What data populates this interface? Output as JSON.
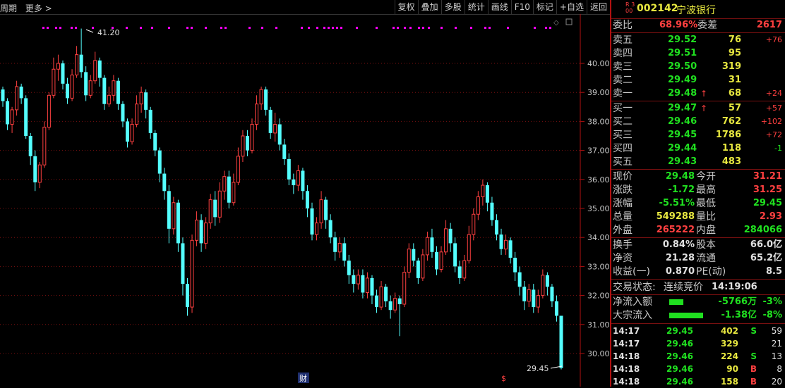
{
  "toolbar": {
    "left_items": [
      "周期",
      "更多 >"
    ],
    "buttons": [
      "复权",
      "叠加",
      "多股",
      "统计",
      "画线",
      "F10",
      "标记",
      "+自选",
      "返回"
    ]
  },
  "chart": {
    "price_ticks": [
      "40.00",
      "39.00",
      "38.00",
      "37.00",
      "36.00",
      "35.00",
      "34.00",
      "33.00",
      "32.00",
      "31.00",
      "30.00"
    ],
    "high_marker": "41.20",
    "low_marker": "29.45",
    "bottom_marks": [
      "财",
      "$"
    ],
    "colors": {
      "up": "#ff4040",
      "down": "#54ffff",
      "grid": "#7a1010",
      "signal": "#ff00ff"
    }
  },
  "quote": {
    "index_badge": "R 300",
    "code": "002142",
    "name": "宁波银行",
    "weibi_label": "委比",
    "weibi_value": "68.96%",
    "weicha_label": "委差",
    "weicha_value": "2617",
    "asks": [
      {
        "label": "卖五",
        "price": "29.52",
        "vol": "76",
        "chg": "+76",
        "arrow": ""
      },
      {
        "label": "卖四",
        "price": "29.51",
        "vol": "95",
        "chg": "",
        "arrow": ""
      },
      {
        "label": "卖三",
        "price": "29.50",
        "vol": "319",
        "chg": "",
        "arrow": ""
      },
      {
        "label": "卖二",
        "price": "29.49",
        "vol": "31",
        "chg": "",
        "arrow": ""
      },
      {
        "label": "卖一",
        "price": "29.48",
        "vol": "68",
        "chg": "+24",
        "arrow": "↑"
      }
    ],
    "bids": [
      {
        "label": "买一",
        "price": "29.47",
        "vol": "57",
        "chg": "+57",
        "arrow": "↑"
      },
      {
        "label": "买二",
        "price": "29.46",
        "vol": "762",
        "chg": "+102",
        "arrow": ""
      },
      {
        "label": "买三",
        "price": "29.45",
        "vol": "1786",
        "chg": "+72",
        "arrow": ""
      },
      {
        "label": "买四",
        "price": "29.44",
        "vol": "118",
        "chg": "-1",
        "arrow": ""
      },
      {
        "label": "买五",
        "price": "29.43",
        "vol": "483",
        "chg": "",
        "arrow": ""
      }
    ],
    "stats": [
      {
        "l1": "现价",
        "v1": "29.48",
        "c1": "green",
        "l2": "今开",
        "v2": "31.21",
        "c2": "red"
      },
      {
        "l1": "涨跌",
        "v1": "-1.72",
        "c1": "green",
        "l2": "最高",
        "v2": "31.25",
        "c2": "red"
      },
      {
        "l1": "涨幅",
        "v1": "-5.51%",
        "c1": "green",
        "l2": "最低",
        "v2": "29.45",
        "c2": "green"
      },
      {
        "l1": "总量",
        "v1": "549288",
        "c1": "yel",
        "l2": "量比",
        "v2": "2.93",
        "c2": "red"
      },
      {
        "l1": "外盘",
        "v1": "265222",
        "c1": "red",
        "l2": "内盘",
        "v2": "284066",
        "c2": "green"
      }
    ],
    "stats2": [
      {
        "l1": "换手",
        "v1": "0.84%",
        "l2": "股本",
        "v2": "66.0亿"
      },
      {
        "l1": "净资",
        "v1": "21.28",
        "l2": "流通",
        "v2": "65.2亿"
      },
      {
        "l1": "收益(一)",
        "v1": "0.870",
        "l2": "PE(动)",
        "v2": "8.5"
      }
    ],
    "trade_status_label": "交易状态:",
    "trade_status": "连续竞价",
    "trade_time": "14:19:06",
    "flows": [
      {
        "label": "净流入额",
        "value": "-5766万",
        "pct": "-3%",
        "bar": 0.28
      },
      {
        "label": "大宗流入",
        "value": "-1.38亿",
        "pct": "-8%",
        "bar": 0.68
      }
    ],
    "ticks": [
      {
        "time": "14:17",
        "price": "29.45",
        "vol": "402",
        "side": "S",
        "n": "59"
      },
      {
        "time": "14:17",
        "price": "29.46",
        "vol": "329",
        "side": "",
        "n": "21"
      },
      {
        "time": "14:18",
        "price": "29.46",
        "vol": "224",
        "side": "S",
        "n": "13"
      },
      {
        "time": "14:18",
        "price": "29.46",
        "vol": "90",
        "side": "B",
        "n": "8"
      },
      {
        "time": "14:18",
        "price": "29.46",
        "vol": "158",
        "side": "B",
        "n": "20"
      }
    ]
  }
}
